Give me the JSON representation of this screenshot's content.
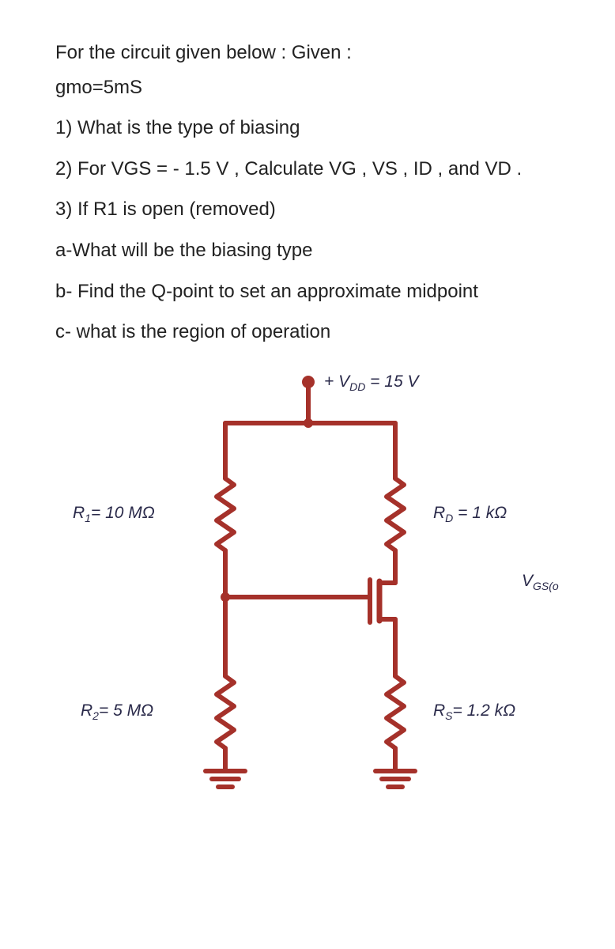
{
  "problem": {
    "intro1": "For the circuit given below   : Given :",
    "intro2": "gmo=5mS",
    "q1": "1)    What is the type of biasing",
    "q2": "2)    For VGS = - 1.5 V  ,  Calculate VG , VS , ID , and VD .",
    "q3": "3)    If R1 is open (removed)",
    "q3a": "a-What will be the biasing type",
    "q3b": "b- Find the Q-point to set an approximate midpoint",
    "q3c": "c- what is the region of operation"
  },
  "circuit": {
    "vdd_label": "+ V",
    "vdd_sub": "DD",
    "vdd_value": " = 15 V",
    "r1_label": "R",
    "r1_sub": "1",
    "r1_value": "= 10 MΩ",
    "r2_label": "R",
    "r2_sub": "2",
    "r2_value": "= 5 MΩ",
    "rd_label": "R",
    "rd_sub": "D",
    "rd_value": " = 1 kΩ",
    "rs_label": "R",
    "rs_sub": "S",
    "rs_value": "= 1.2 kΩ",
    "vgs_label": "V",
    "vgs_sub": "GS(o"
  }
}
